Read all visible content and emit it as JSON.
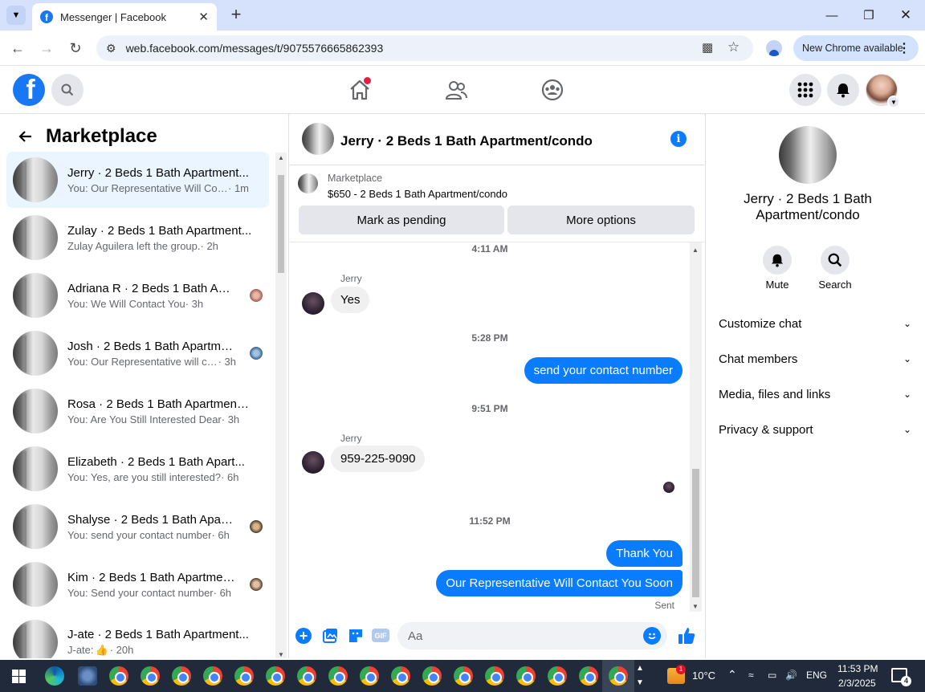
{
  "browser": {
    "tab_title": "Messenger | Facebook",
    "url": "web.facebook.com/messages/t/9075576665862393",
    "new_chrome": "New Chrome available"
  },
  "sidebar": {
    "title": "Marketplace",
    "conversations": [
      {
        "name": "Jerry · 2 Beds 1 Bath Apartment...",
        "snippet": "You: Our Representative Will Cont...",
        "time": " · 1m"
      },
      {
        "name": "Zulay · 2 Beds 1 Bath Apartment...",
        "snippet": "Zulay Aguilera left the group.",
        "time": " · 2h"
      },
      {
        "name": "Adriana R · 2 Beds 1 Bath Apa...",
        "snippet": "You: We Will Contact You",
        "time": " · 3h"
      },
      {
        "name": "Josh · 2 Beds 1 Bath Apartme...",
        "snippet": "You: Our Representative will con...",
        "time": " · 3h"
      },
      {
        "name": "Rosa · 2 Beds 1 Bath Apartment/...",
        "snippet": "You: Are You Still Interested Dear",
        "time": " · 3h"
      },
      {
        "name": "Elizabeth · 2 Beds 1 Bath Apart...",
        "snippet": "You: Yes, are you still interested?",
        "time": " · 6h"
      },
      {
        "name": "Shalyse · 2 Beds 1 Bath Apart...",
        "snippet": "You: send your contact number",
        "time": " · 6h"
      },
      {
        "name": "Kim · 2 Beds 1 Bath Apartmen...",
        "snippet": "You: Send your contact number",
        "time": " · 6h"
      },
      {
        "name": "J-ate · 2 Beds 1 Bath Apartment...",
        "snippet": "J-ate:",
        "time": " · 20h"
      }
    ]
  },
  "chat": {
    "title": "Jerry · 2 Beds 1 Bath Apartment/condo",
    "marketplace_label": "Marketplace",
    "listing": "$650 - 2 Beds 1 Bath Apartment/condo",
    "mark_pending": "Mark as pending",
    "more_options": "More options",
    "messages": {
      "ts1": "4:11 AM",
      "sender1": "Jerry",
      "msg1": "Yes",
      "ts2": "5:28 PM",
      "msg2": "send your contact number",
      "ts3": "9:51 PM",
      "sender2": "Jerry",
      "msg3": "959-225-9090",
      "ts4": "11:52 PM",
      "msg4": "Thank You",
      "msg5": "Our Representative Will Contact You Soon",
      "status": "Sent"
    },
    "compose_placeholder": "Aa",
    "gif_label": "GIF"
  },
  "details": {
    "title": "Jerry · 2 Beds 1 Bath Apartment/condo",
    "mute": "Mute",
    "search": "Search",
    "rows": [
      "Customize chat",
      "Chat members",
      "Media, files and links",
      "Privacy & support"
    ]
  },
  "taskbar": {
    "weather": "10°C",
    "lang": "ENG",
    "time": "11:53 PM",
    "date": "2/3/2025",
    "notif_count": "4",
    "weather_badge": "1"
  },
  "colors": {
    "brand": "#1877f2",
    "bubble_out": "#0a7cff",
    "active_row": "#ebf5ff"
  }
}
